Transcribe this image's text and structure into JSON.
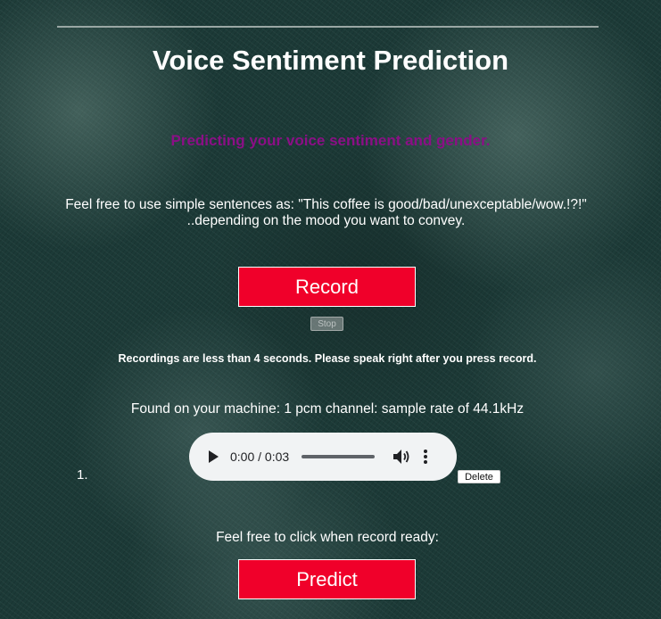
{
  "page": {
    "title": "Voice Sentiment Prediction",
    "subtitle": "Predicting your voice sentiment and gender.",
    "hint_line1": "Feel free to use simple sentences as: \"This coffee is good/bad/unexceptable/wow.!?!\"",
    "hint_line2": "..depending on the mood you want to convey."
  },
  "controls": {
    "record_label": "Record",
    "stop_label": "Stop",
    "note": "Recordings are less than 4 seconds. Please speak right after you press record.",
    "machine_info": "Found on your machine: 1 pcm channel: sample rate of 44.1kHz"
  },
  "recordings": [
    {
      "index": "1.",
      "time": "0:00 / 0:03",
      "progress": 0,
      "delete_label": "Delete"
    }
  ],
  "predict": {
    "prompt": "Feel free to click when record ready:",
    "button_label": "Predict"
  },
  "colors": {
    "accent_red": "#f0002a",
    "subtitle_purple": "#8b0f86",
    "background": "#1c3a37"
  },
  "icons": {
    "play": "play-icon",
    "volume": "volume-icon",
    "more": "more-vert-icon"
  }
}
